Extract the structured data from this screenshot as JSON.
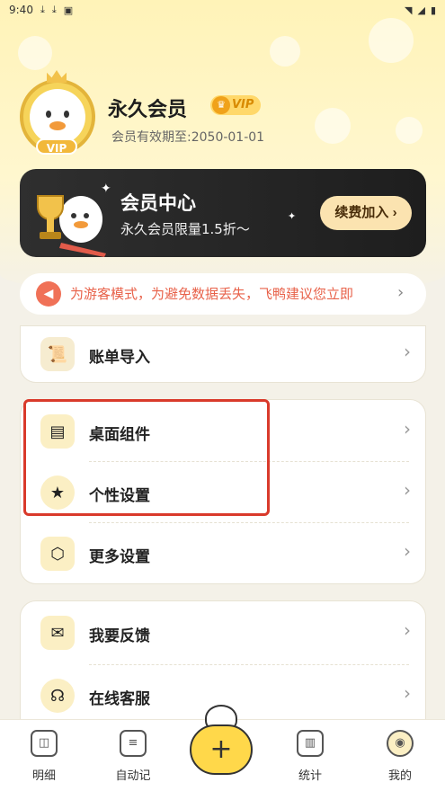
{
  "status_bar": {
    "time": "9:40",
    "left_icons": [
      "download-icon",
      "download-icon",
      "image-icon"
    ],
    "right_icons": [
      "wifi-icon",
      "signal-icon",
      "battery-icon"
    ]
  },
  "profile": {
    "name": "永久会员",
    "vip_badge": "VIP",
    "avatar_badge": "VIP",
    "expiry": "会员有效期至:2050-01-01"
  },
  "member_card": {
    "title": "会员中心",
    "subtitle": "永久会员限量1.5折～",
    "button": "续费加入"
  },
  "notice": {
    "text": "为游客模式，为避免数据丢失，飞鸭建议您立即"
  },
  "menu": {
    "import": "账单导入",
    "widget": "桌面组件",
    "personal": "个性设置",
    "more": "更多设置",
    "feedback": "我要反馈",
    "service": "在线客服"
  },
  "nav": {
    "detail": "明细",
    "auto": "自动记",
    "add": "+",
    "stats": "统计",
    "mine": "我的"
  },
  "colors": {
    "accent": "#ffd84a",
    "notice": "#e8624a",
    "highlight": "#d93a2b"
  }
}
